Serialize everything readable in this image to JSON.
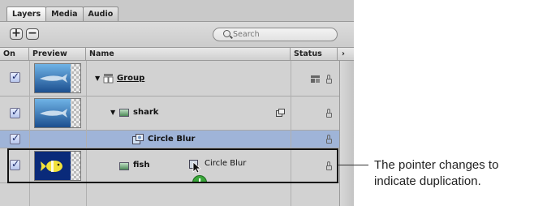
{
  "tabs": [
    {
      "label": "Layers",
      "active": true
    },
    {
      "label": "Media",
      "active": false
    },
    {
      "label": "Audio",
      "active": false
    }
  ],
  "toolbar": {
    "add_icon": "plus-icon",
    "remove_icon": "minus-icon",
    "search_placeholder": "Search"
  },
  "columns": {
    "on": "On",
    "preview": "Preview",
    "name": "Name",
    "status": "Status",
    "expand_icon": "chevron-right-icon"
  },
  "rows": [
    {
      "name": "Group",
      "checked": true,
      "underlined": true,
      "disclosure": "▼",
      "icon": "group-icon",
      "status_icons": [
        "group-status-icon",
        "lock-icon"
      ]
    },
    {
      "name": "shark",
      "checked": true,
      "disclosure": "▼",
      "icon": "image-layer-icon",
      "extra_icon": "filter-badge-icon",
      "status_icons": [
        "lock-icon"
      ]
    },
    {
      "name": "Circle Blur",
      "checked": true,
      "highlighted": true,
      "icon": "filter-icon",
      "status_icons": [
        "lock-icon"
      ]
    },
    {
      "name": "fish",
      "checked": true,
      "icon": "image-layer-icon",
      "drag_label": "Circle Blur",
      "drag_icon": "pointer-with-filter-icon",
      "status_icons": [
        "lock-icon"
      ]
    }
  ],
  "drag_cursor_icon": "duplicate-plus-icon",
  "callout": {
    "line1": "The pointer changes to",
    "line2": "indicate duplication."
  },
  "colors": {
    "panel_bg": "#c9c9c9",
    "highlight_row": "#9fb4d8",
    "accent_green": "#3aa63a"
  }
}
